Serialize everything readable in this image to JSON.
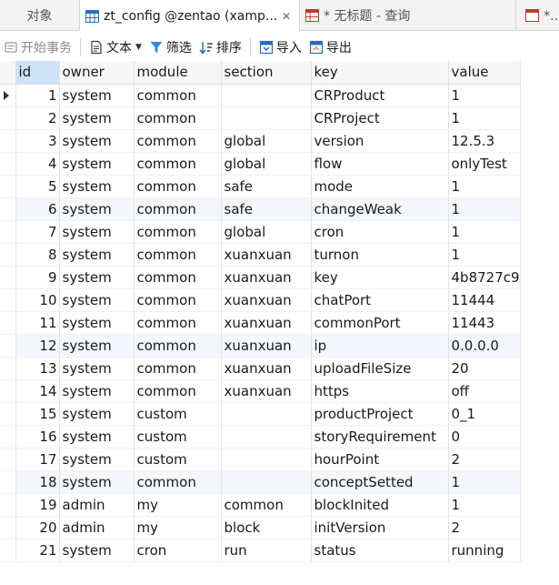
{
  "tabs": {
    "objects": "对象",
    "active": "zt_config @zentao (xamp...",
    "query": "* 无标题 - 查询",
    "partial": "* 无"
  },
  "toolbar": {
    "begin_transaction": "开始事务",
    "text": "文本",
    "filter": "筛选",
    "sort": "排序",
    "import": "导入",
    "export": "导出"
  },
  "grid": {
    "columns": [
      "id",
      "owner",
      "module",
      "section",
      "key",
      "value"
    ],
    "rows": [
      [
        "1",
        "system",
        "common",
        "",
        "CRProduct",
        "1"
      ],
      [
        "2",
        "system",
        "common",
        "",
        "CRProject",
        "1"
      ],
      [
        "3",
        "system",
        "common",
        "global",
        "version",
        "12.5.3"
      ],
      [
        "4",
        "system",
        "common",
        "global",
        "flow",
        "onlyTest"
      ],
      [
        "5",
        "system",
        "common",
        "safe",
        "mode",
        "1"
      ],
      [
        "6",
        "system",
        "common",
        "safe",
        "changeWeak",
        "1"
      ],
      [
        "7",
        "system",
        "common",
        "global",
        "cron",
        "1"
      ],
      [
        "8",
        "system",
        "common",
        "xuanxuan",
        "turnon",
        "1"
      ],
      [
        "9",
        "system",
        "common",
        "xuanxuan",
        "key",
        "4b8727c9"
      ],
      [
        "10",
        "system",
        "common",
        "xuanxuan",
        "chatPort",
        "11444"
      ],
      [
        "11",
        "system",
        "common",
        "xuanxuan",
        "commonPort",
        "11443"
      ],
      [
        "12",
        "system",
        "common",
        "xuanxuan",
        "ip",
        "0.0.0.0"
      ],
      [
        "13",
        "system",
        "common",
        "xuanxuan",
        "uploadFileSize",
        "20"
      ],
      [
        "14",
        "system",
        "common",
        "xuanxuan",
        "https",
        "off"
      ],
      [
        "15",
        "system",
        "custom",
        "",
        "productProject",
        "0_1"
      ],
      [
        "16",
        "system",
        "custom",
        "",
        "storyRequirement",
        "0"
      ],
      [
        "17",
        "system",
        "custom",
        "",
        "hourPoint",
        "2"
      ],
      [
        "18",
        "system",
        "common",
        "",
        "conceptSetted",
        "1"
      ],
      [
        "19",
        "admin",
        "my",
        "common",
        "blockInited",
        "1"
      ],
      [
        "20",
        "admin",
        "my",
        "block",
        "initVersion",
        "2"
      ],
      [
        "21",
        "system",
        "cron",
        "run",
        "status",
        "running"
      ]
    ]
  },
  "colors": {
    "accent": "#2a6ebb",
    "header_selected": "#cfe3f7",
    "row_alt": "#f4f8fc"
  }
}
